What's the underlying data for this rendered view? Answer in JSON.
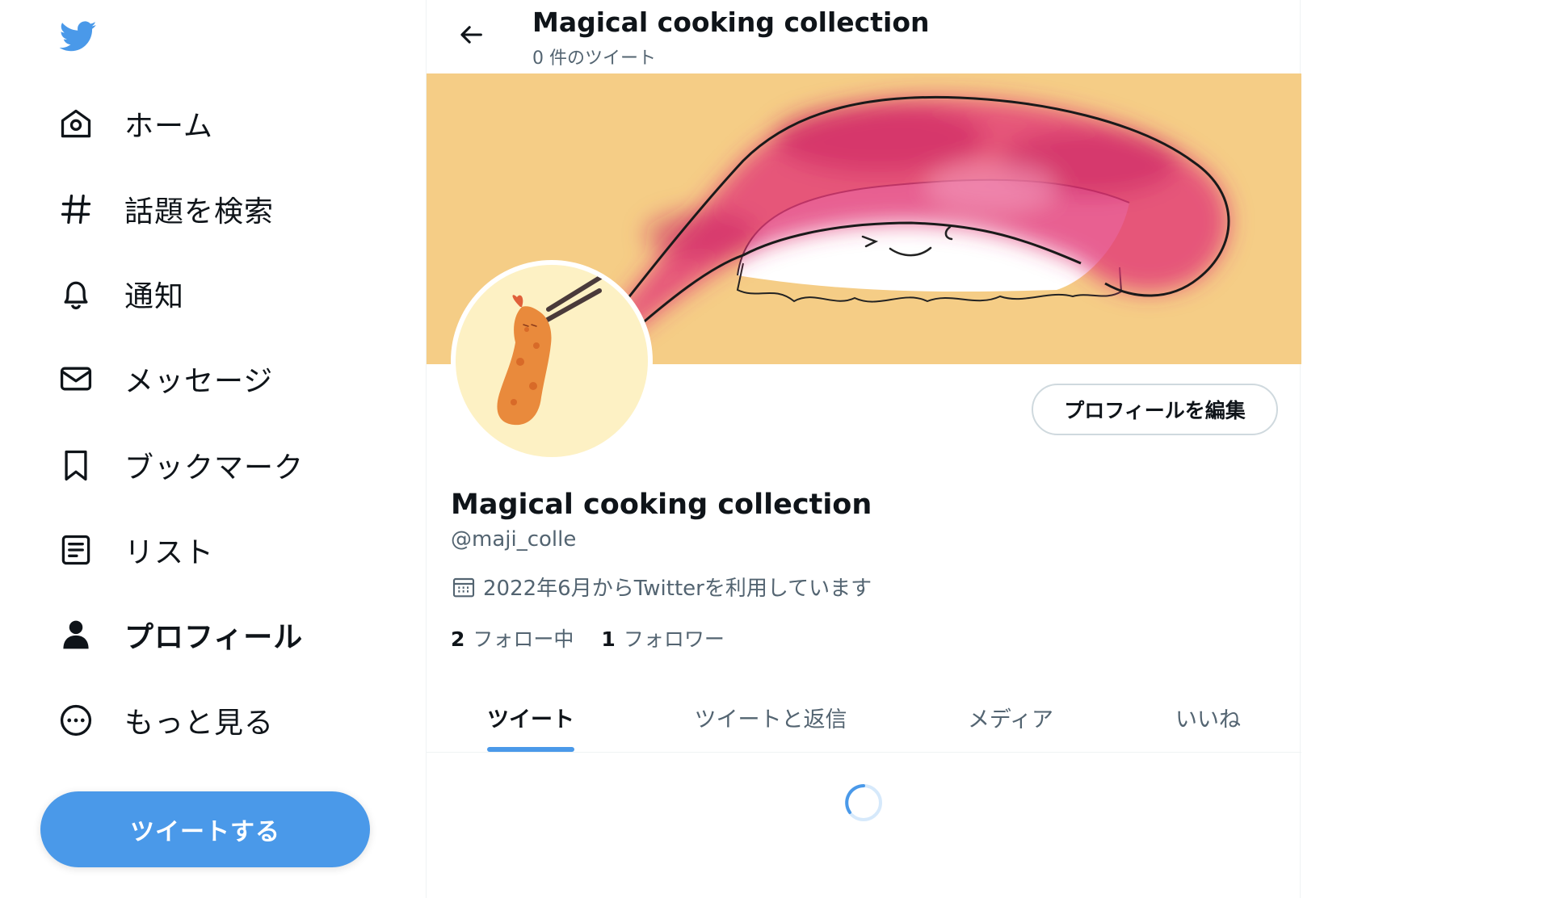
{
  "sidebar": {
    "nav": [
      {
        "label": "ホーム",
        "icon": "home-icon"
      },
      {
        "label": "話題を検索",
        "icon": "hashtag-icon"
      },
      {
        "label": "通知",
        "icon": "bell-icon"
      },
      {
        "label": "メッセージ",
        "icon": "envelope-icon"
      },
      {
        "label": "ブックマーク",
        "icon": "bookmark-icon"
      },
      {
        "label": "リスト",
        "icon": "list-icon"
      },
      {
        "label": "プロフィール",
        "icon": "person-icon",
        "active": true
      },
      {
        "label": "もっと見る",
        "icon": "more-icon"
      }
    ],
    "tweet_button": "ツイートする"
  },
  "header": {
    "title": "Magical cooking collection",
    "subtitle": "0 件のツイート"
  },
  "profile": {
    "edit_button": "プロフィールを編集",
    "name": "Magical cooking collection",
    "handle": "@maji_colle",
    "joined": "2022年6月からTwitterを利用しています",
    "following_count": "2",
    "following_label": "フォロー中",
    "followers_count": "1",
    "followers_label": "フォロワー"
  },
  "tabs": [
    "ツイート",
    "ツイートと返信",
    "メディア",
    "いいね"
  ],
  "colors": {
    "accent": "#4a99e9",
    "banner_bg": "#f5cd86",
    "avatar_bg": "#fdf1c4",
    "muted_text": "#536471"
  }
}
